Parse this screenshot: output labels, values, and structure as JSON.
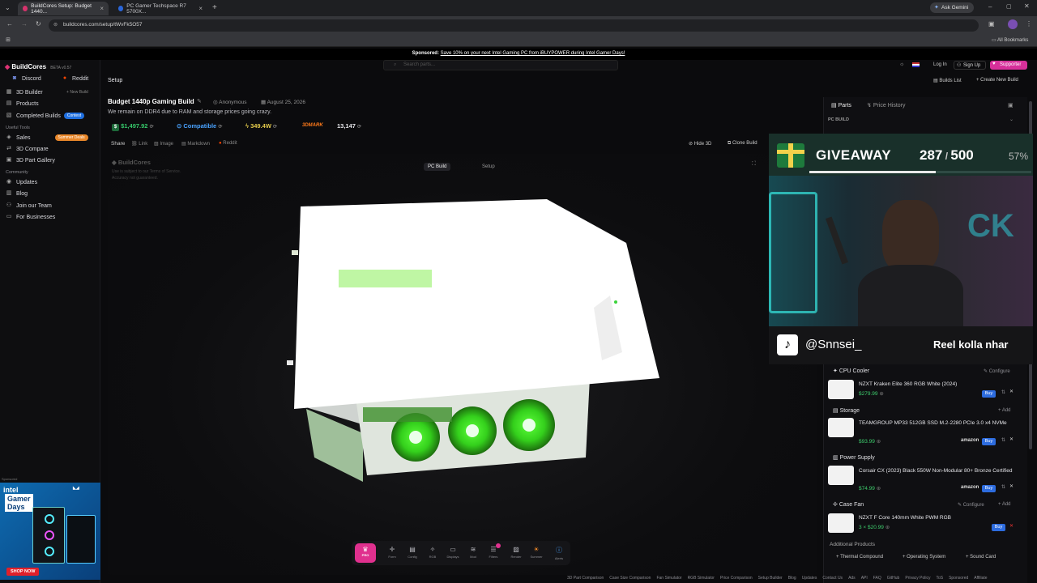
{
  "browser": {
    "tabs": [
      {
        "label": "BuildCores Setup: Budget 1440..."
      },
      {
        "label": "PC Gamer Techspace R7 5700X..."
      }
    ],
    "ask_gemini": "Ask Gemini",
    "url": "buildcores.com/setup/tWvFk5O57",
    "all_bookmarks": "All Bookmarks"
  },
  "sponsor": {
    "prefix": "Sponsored:",
    "text": "Save 10% on your next Intel Gaming PC from iBUYPOWER during Intel Gamer Days!"
  },
  "topnav": {
    "search_placeholder": "Search parts...",
    "login": "Log In",
    "signup": "Sign Up",
    "supporter": "Supporter"
  },
  "sidebar": {
    "brand": "BuildCores",
    "version": "BETA v0.57",
    "discord": "Discord",
    "reddit": "Reddit",
    "new_build": "New Build",
    "items": [
      {
        "label": "3D Builder"
      },
      {
        "label": "Products"
      },
      {
        "label": "Completed Builds",
        "badge": "Contest"
      }
    ],
    "useful_tools": "Useful Tools",
    "tools": [
      {
        "label": "Sales",
        "badge": "Summer Deals"
      },
      {
        "label": "3D Compare"
      },
      {
        "label": "3D Part Gallery"
      }
    ],
    "community": "Community",
    "community_items": [
      {
        "label": "Updates"
      },
      {
        "label": "Blog"
      },
      {
        "label": "Join our Team"
      },
      {
        "label": "For Businesses"
      }
    ]
  },
  "ad": {
    "sponsored": "Sponsored",
    "brand": "intel",
    "headline_1": "Gamer",
    "headline_2": "Days",
    "cta": "SHOP NOW"
  },
  "header": {
    "crumb": "Setup",
    "builds_list": "Builds List",
    "create_new": "Create New Build"
  },
  "build": {
    "title": "Budget 1440p Gaming Build",
    "author": "Anonymous",
    "date": "August 25, 2026",
    "description": "We remain on DDR4 due to RAM and storage prices going crazy.",
    "price": "$1,497.92",
    "compat": "Compatible",
    "wattage": "349.4W",
    "mark_label": "3DMARK",
    "mark_score": "13,147",
    "share": "Share",
    "share_opts": [
      "Link",
      "Image",
      "Markdown",
      "Reddit"
    ],
    "hide_3d": "Hide 3D",
    "clone": "Clone Build"
  },
  "canvas": {
    "watermark_brand": "BuildCores",
    "watermark_line1": "Use is subject to our Terms of Service.",
    "watermark_line2": "Accuracy not guaranteed.",
    "tab_build": "PC Build",
    "tab_setup": "Setup"
  },
  "toolbar": {
    "items": [
      {
        "label": "PRO"
      },
      {
        "label": "Form"
      },
      {
        "label": "Config"
      },
      {
        "label": "RGB"
      },
      {
        "label": "Displays"
      },
      {
        "label": "Mod"
      },
      {
        "label": "Filters"
      },
      {
        "label": "Render"
      },
      {
        "label": "Summer"
      },
      {
        "label": "Alerts"
      }
    ]
  },
  "right_panel": {
    "tab_parts": "Parts",
    "tab_history": "Price History",
    "section": "PC BUILD",
    "parts": [
      {
        "category": "CPU Cooler",
        "action": "Configure",
        "name": "NZXT Kraken Elite 360 RGB White (2024)",
        "price": "$279.99"
      },
      {
        "category": "Storage",
        "action": "Add",
        "name": "TEAMGROUP MP33 512GB SSD M.2-2280 PCIe 3.0 x4 NVMe",
        "price": "$93.99",
        "store": "amazon"
      },
      {
        "category": "Power Supply",
        "action": "",
        "name": "Corsair CX (2023) Black 550W Non-Modular 80+ Bronze Certified",
        "price": "$74.99",
        "store": "amazon"
      },
      {
        "category": "Case Fan",
        "action": "Configure",
        "action2": "Add",
        "name": "NZXT F Core 140mm White PWM RGB",
        "price": "3 × $20.99"
      }
    ],
    "buy": "Buy",
    "additional": "Additional Products",
    "additional_items": [
      "Thermal Compound",
      "Operating System",
      "Sound Card"
    ]
  },
  "overlay": {
    "giveaway": "GIVEAWAY",
    "count": "287",
    "total": "500",
    "percent": "57%",
    "progress": 0.57,
    "handle": "@Snnsei_",
    "caption": "Reel kolla nhar"
  },
  "footer": {
    "links": [
      "3D Part Comparison",
      "Case Size Comparison",
      "Fan Simulator",
      "RGB Simulator",
      "Price Comparison",
      "Setup Builder",
      "Blog",
      "Updates",
      "Contact Us",
      "Ads",
      "API",
      "FAQ",
      "GitHub",
      "Privacy Policy",
      "ToS",
      "Sponsored",
      "Affiliate"
    ]
  }
}
